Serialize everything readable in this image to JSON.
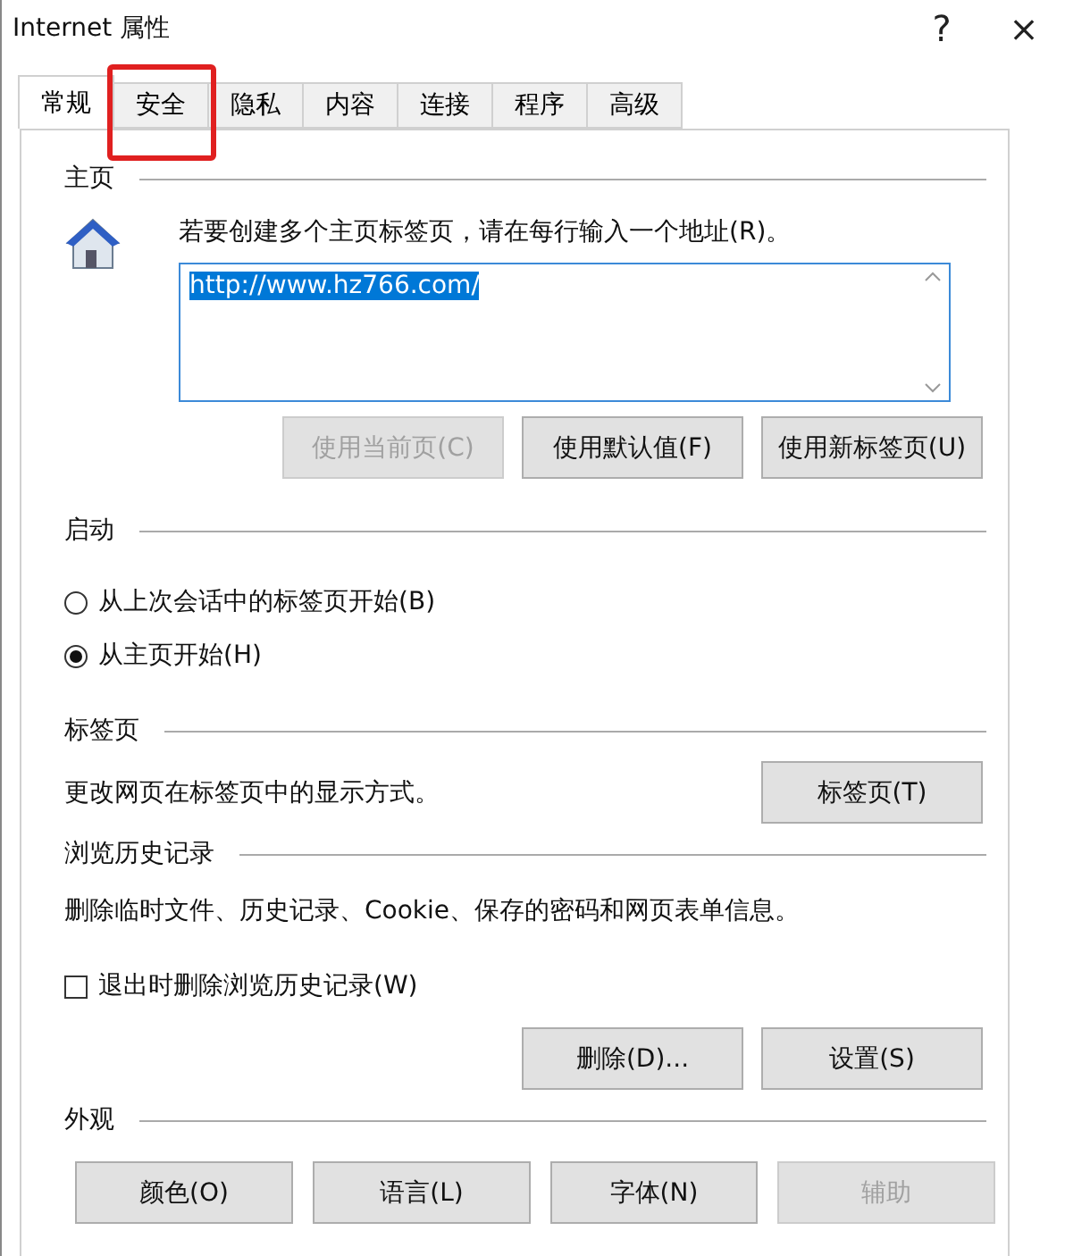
{
  "window": {
    "title": "Internet 属性",
    "help": "?",
    "close": "×"
  },
  "tabs": [
    {
      "label": "常规",
      "selected": true,
      "highlighted": false
    },
    {
      "label": "安全",
      "selected": false,
      "highlighted": true
    },
    {
      "label": "隐私",
      "selected": false,
      "highlighted": false
    },
    {
      "label": "内容",
      "selected": false,
      "highlighted": false
    },
    {
      "label": "连接",
      "selected": false,
      "highlighted": false
    },
    {
      "label": "程序",
      "selected": false,
      "highlighted": false
    },
    {
      "label": "高级",
      "selected": false,
      "highlighted": false
    }
  ],
  "home": {
    "heading": "主页",
    "instruction": "若要创建多个主页标签页，请在每行输入一个地址(R)。",
    "value": "http://www.hz766.com/",
    "value_selected": true,
    "buttons": [
      {
        "label": "使用当前页(C)",
        "disabled": true
      },
      {
        "label": "使用默认值(F)",
        "disabled": false
      },
      {
        "label": "使用新标签页(U)",
        "disabled": false
      }
    ]
  },
  "startup": {
    "heading": "启动",
    "options": [
      {
        "label": "从上次会话中的标签页开始(B)",
        "selected": false
      },
      {
        "label": "从主页开始(H)",
        "selected": true
      }
    ]
  },
  "tabs_section": {
    "heading": "标签页",
    "description": "更改网页在标签页中的显示方式。",
    "button": "标签页(T)"
  },
  "history": {
    "heading": "浏览历史记录",
    "description": "删除临时文件、历史记录、Cookie、保存的密码和网页表单信息。",
    "checkbox": {
      "label": "退出时删除浏览历史记录(W)",
      "checked": false
    },
    "buttons": [
      {
        "label": "删除(D)...",
        "disabled": false
      },
      {
        "label": "设置(S)",
        "disabled": false
      }
    ]
  },
  "appearance": {
    "heading": "外观",
    "buttons": [
      {
        "label": "颜色(O)",
        "disabled": false
      },
      {
        "label": "语言(L)",
        "disabled": false
      },
      {
        "label": "字体(N)",
        "disabled": false
      },
      {
        "label": "辅助",
        "disabled": true
      }
    ]
  }
}
